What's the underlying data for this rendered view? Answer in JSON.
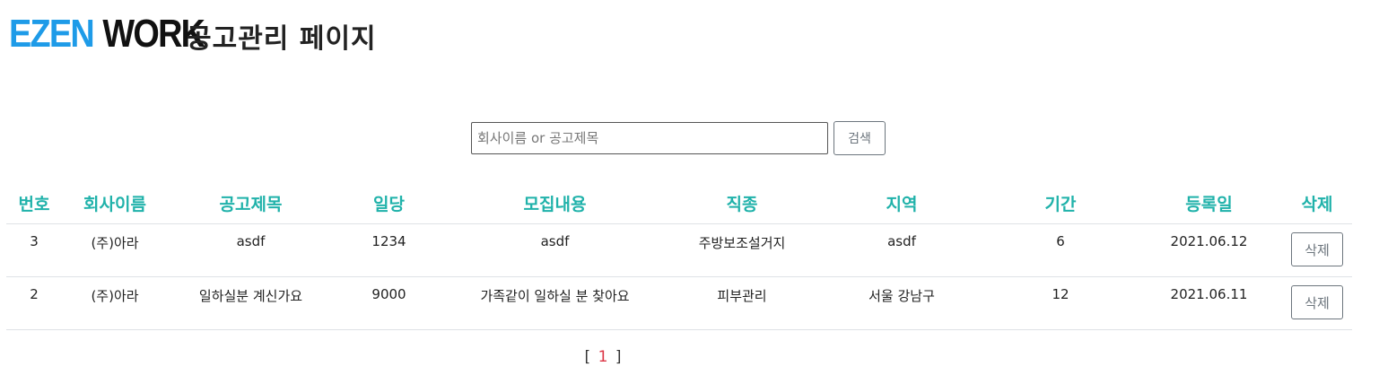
{
  "logo": {
    "part1": "EZEN",
    "part2": "WORK"
  },
  "page_title": "공고관리 페이지",
  "search": {
    "placeholder": "회사이름 or 공고제목",
    "value": "",
    "button_label": "검색"
  },
  "table": {
    "headers": [
      "번호",
      "회사이름",
      "공고제목",
      "일당",
      "모집내용",
      "직종",
      "지역",
      "기간",
      "등록일",
      "삭제"
    ],
    "rows": [
      {
        "no": "3",
        "company": "(주)아라",
        "title": "asdf",
        "pay": "1234",
        "content": "asdf",
        "job": "주방보조설거지",
        "region": "asdf",
        "period": "6",
        "date": "2021.06.12",
        "delete_label": "삭제"
      },
      {
        "no": "2",
        "company": "(주)아라",
        "title": "일하실분 계신가요",
        "pay": "9000",
        "content": "가족같이 일하실 분 찾아요",
        "job": "피부관리",
        "region": "서울 강남구",
        "period": "12",
        "date": "2021.06.11",
        "delete_label": "삭제"
      }
    ]
  },
  "pagination": {
    "open": "[",
    "current": "1",
    "close": "]"
  },
  "colors": {
    "logo_blue": "#1e9be8",
    "header_teal": "#20b2aa",
    "page_red": "#dc3545"
  }
}
